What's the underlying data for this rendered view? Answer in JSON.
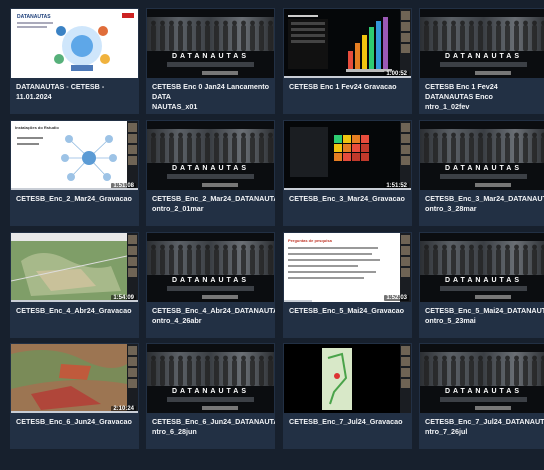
{
  "banner": {
    "title": "DATANAUTAS"
  },
  "thumb_text": {
    "web_title": "DATANAUTAS",
    "slide_title": "Instalações do Rstudio",
    "chart_title": "Perguntas de pesquisa"
  },
  "cards": [
    {
      "title": "DATANAUTAS - CETESB - 11.01.2024",
      "kind": "poster",
      "duration": "",
      "progress": 0
    },
    {
      "title": "CETESB Enc 0 Jan24 Lancamento DATA\nNAUTAS_x01",
      "kind": "banner",
      "duration": "",
      "progress": 0
    },
    {
      "title": "CETESB Enc 1 Fev24 Gravacao",
      "kind": "chart",
      "duration": "1:00:52",
      "progress": 1.0
    },
    {
      "title": "CETESB Enc 1 Fev24 DATANAUTAS Enco\nntro_1_02fev",
      "kind": "banner",
      "duration": "",
      "progress": 0
    },
    {
      "title": "CETESB_Enc_2_Mar24_Gravacao",
      "kind": "mindmap",
      "duration": "1:51:08",
      "progress": 1.0
    },
    {
      "title": "CETESB_Enc_2_Mar24_DATANAUTAS_Enc\nontro_2_01mar",
      "kind": "banner",
      "duration": "",
      "progress": 0
    },
    {
      "title": "CETESB_Enc_3_Mar24_Gravacao",
      "kind": "matrix",
      "duration": "1:51:52",
      "progress": 1.0
    },
    {
      "title": "CETESB_Enc_3_Mar24_DATANAUTAS_Enc\nontro_3_28mar",
      "kind": "banner",
      "duration": "",
      "progress": 0
    },
    {
      "title": "CETESB_Enc_4_Abr24_Gravacao",
      "kind": "map",
      "duration": "1:54:09",
      "progress": 1.0
    },
    {
      "title": "CETESB_Enc_4_Abr24_DATANAUTAS_Enc\nontro_4_26abr",
      "kind": "banner",
      "duration": "",
      "progress": 0
    },
    {
      "title": "CETESB_Enc_5_Mai24_Gravacao",
      "kind": "slides",
      "duration": "1:52:03",
      "progress": 0.22
    },
    {
      "title": "CETESB_Enc_5_Mai24_DATANAUTAS_Enc\nontro_5_23mai",
      "kind": "banner",
      "duration": "",
      "progress": 0
    },
    {
      "title": "CETESB_Enc_6_Jun24_Gravacao",
      "kind": "satellite",
      "duration": "2:10:24",
      "progress": 1.0
    },
    {
      "title": "CETESB_Enc_6_Jun24_DATANAUTAS_Enco\nntro_6_28jun",
      "kind": "banner",
      "duration": "",
      "progress": 0
    },
    {
      "title": "CETESB_Enc_7_Jul24_Gravacao",
      "kind": "blackmap",
      "duration": "",
      "progress": 0
    },
    {
      "title": "CETESB_Enc_7_Jul24_DATANAUTAS_Enco\nntro_7_26jul",
      "kind": "banner",
      "duration": "",
      "progress": 0
    }
  ],
  "colors": {
    "background": "#17202d",
    "card": "#223044",
    "caption": "#f1f3f6"
  }
}
